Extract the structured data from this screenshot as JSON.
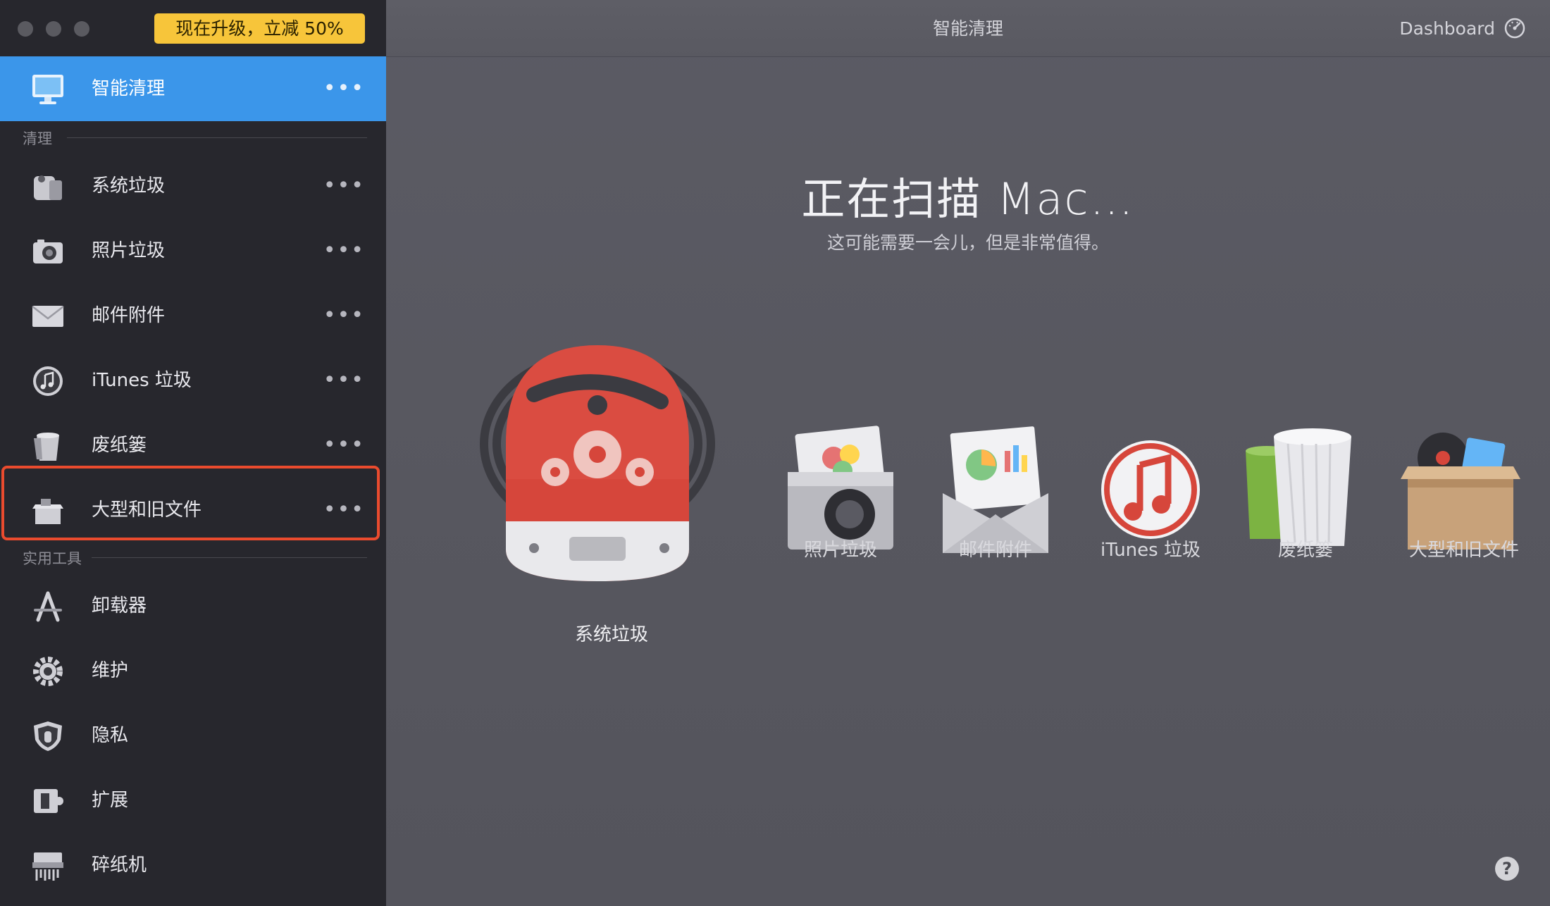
{
  "promo": "现在升级，立减 50%",
  "sidebar": {
    "active": {
      "label": "智能清理",
      "more": "•••",
      "icon": "monitor-icon"
    },
    "section_clean": "清理",
    "clean_items": [
      {
        "label": "系统垃圾",
        "more": "•••",
        "icon": "system-junk-icon"
      },
      {
        "label": "照片垃圾",
        "more": "•••",
        "icon": "camera-icon"
      },
      {
        "label": "邮件附件",
        "more": "•••",
        "icon": "envelope-icon"
      },
      {
        "label": "iTunes 垃圾",
        "more": "•••",
        "icon": "music-note-icon"
      },
      {
        "label": "废纸篓",
        "more": "•••",
        "icon": "trash-icon"
      },
      {
        "label": "大型和旧文件",
        "more": "•••",
        "icon": "box-icon"
      }
    ],
    "section_tools": "实用工具",
    "tool_items": [
      {
        "label": "卸载器",
        "icon": "uninstaller-icon"
      },
      {
        "label": "维护",
        "icon": "gear-icon"
      },
      {
        "label": "隐私",
        "icon": "shield-hand-icon"
      },
      {
        "label": "扩展",
        "icon": "extension-icon"
      },
      {
        "label": "碎纸机",
        "icon": "shredder-icon"
      }
    ]
  },
  "main": {
    "title": "智能清理",
    "dashboard": "Dashboard",
    "scan_title": "正在扫描 Mac…",
    "scan_subtitle": "这可能需要一会儿，但是非常值得。",
    "vacuum_label": "系统垃圾",
    "categories": [
      {
        "label": "照片垃圾",
        "icon": "photo-junk-icon"
      },
      {
        "label": "邮件附件",
        "icon": "mail-attachments-icon"
      },
      {
        "label": "iTunes 垃圾",
        "icon": "itunes-icon"
      },
      {
        "label": "废纸篓",
        "icon": "trash-bins-icon"
      },
      {
        "label": "大型和旧文件",
        "icon": "large-old-files-icon"
      }
    ],
    "help": "?"
  },
  "colors": {
    "sidebar_bg": "#27272d",
    "active_bg": "#3b96ea",
    "promo_bg": "#f7c53a",
    "highlight_border": "#ea4b2e",
    "main_bg": "#57575f",
    "vacuum_red": "#d6463b"
  }
}
